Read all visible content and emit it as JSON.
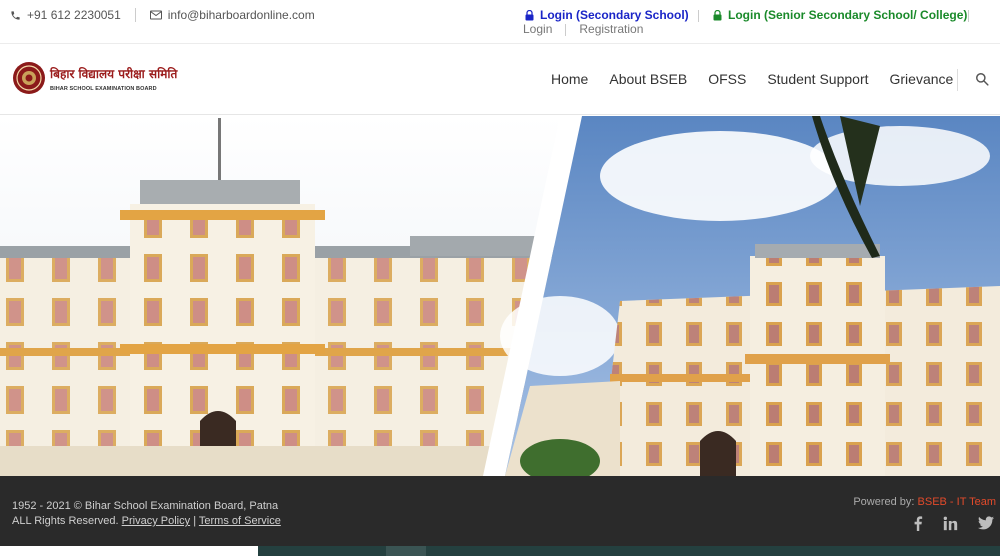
{
  "topbar": {
    "phone": "+91 612 2230051",
    "email": "info@biharboardonline.com",
    "login_secondary": "Login (Secondary School)",
    "login_senior": "Login (Senior Secondary School/ College)",
    "sub_login": "Login",
    "sub_registration": "Registration"
  },
  "brand": {
    "hindi_name": "बिहार विद्यालय परीक्षा समिति",
    "english_name": "BIHAR SCHOOL EXAMINATION BOARD"
  },
  "nav": {
    "items": [
      {
        "label": "Home"
      },
      {
        "label": "About BSEB"
      },
      {
        "label": "OFSS"
      },
      {
        "label": "Student Support"
      },
      {
        "label": "Grievance"
      }
    ]
  },
  "footer": {
    "copyright": "1952 - 2021 © Bihar School Examination Board, Patna",
    "rights": "ALL Rights Reserved.",
    "privacy": "Privacy Policy",
    "divider": "|",
    "terms": "Terms of Service",
    "powered_by": "Powered by:",
    "team": "BSEB - IT Team"
  },
  "colors": {
    "login_secondary": "#1a25c7",
    "login_senior": "#1a8a2a",
    "footer_bg": "#2a2a2a",
    "accent": "#e24a2b"
  },
  "icons": [
    "phone-icon",
    "envelope-icon",
    "lock-icon",
    "search-icon",
    "facebook-icon",
    "linkedin-icon",
    "twitter-icon"
  ]
}
